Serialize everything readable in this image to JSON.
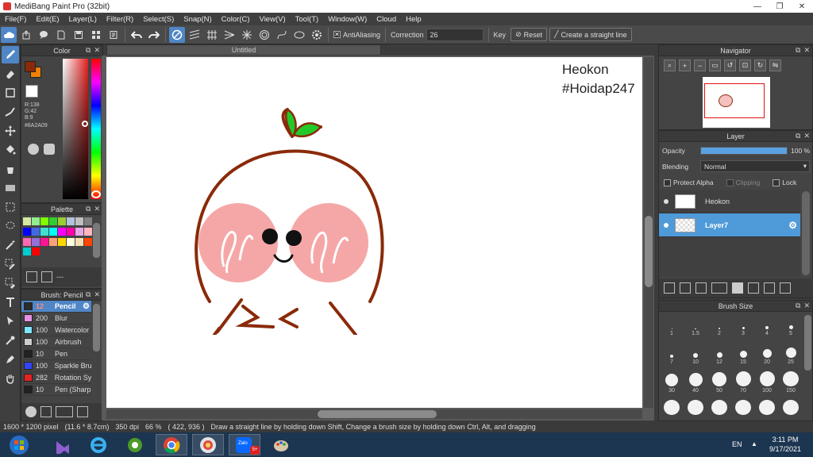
{
  "titlebar": {
    "title": "MediBang Paint Pro (32bit)",
    "minimize": "—",
    "maximize": "❐",
    "close": "✕"
  },
  "menu": [
    "File(F)",
    "Edit(E)",
    "Layer(L)",
    "Filter(R)",
    "Select(S)",
    "Snap(N)",
    "Color(C)",
    "View(V)",
    "Tool(T)",
    "Window(W)",
    "Cloud",
    "Help"
  ],
  "toolbar": {
    "antialiasing": "AntiAliasing",
    "correction_label": "Correction",
    "correction_value": "26",
    "key_label": "Key",
    "reset_label": "Reset",
    "straight_line_label": "Create a straight line"
  },
  "document": {
    "tab": "Untitled",
    "canvas_text_line1": "Heokon",
    "canvas_text_line2": "#Hoidap247"
  },
  "color_panel": {
    "title": "Color",
    "r": "R:138",
    "g": "G:42",
    "b": "B:9",
    "hex": "#8A2A09",
    "primary": "#8A2A09"
  },
  "palette_panel": {
    "title": "Palette",
    "more": "---",
    "colors": [
      "#d6e8a2",
      "#90ee90",
      "#7fff00",
      "#32cd32",
      "#9acd32",
      "#b0c4de",
      "#c0c0c0",
      "#808080",
      "#0000ff",
      "#4169e1",
      "#40e0d0",
      "#00ffff",
      "#ff00ff",
      "#ff00aa",
      "#e6a8e6",
      "#ffb6c1",
      "#ff69b4",
      "#9370db",
      "#ff1493",
      "#ffa07a",
      "#ffd700",
      "#ffffe0",
      "#f5deb3",
      "#ff4500",
      "#00ced1",
      "#ff0000"
    ]
  },
  "brush_panel": {
    "title": "Brush: Pencil",
    "items": [
      {
        "size": "12",
        "name": "Pencil",
        "color": "#2b2b2b"
      },
      {
        "size": "200",
        "name": "Blur",
        "color": "#e690e6"
      },
      {
        "size": "100",
        "name": "Watercolor",
        "color": "#7fe6ff"
      },
      {
        "size": "100",
        "name": "Airbrush",
        "color": "#cccccc"
      },
      {
        "size": "10",
        "name": "Pen",
        "color": "#222222"
      },
      {
        "size": "100",
        "name": "Sparkle Bru",
        "color": "#3344ff"
      },
      {
        "size": "282",
        "name": "Rotation Sy",
        "color": "#e62222"
      },
      {
        "size": "10",
        "name": "Pen (Sharp",
        "color": "#222222"
      }
    ]
  },
  "navigator": {
    "title": "Navigator"
  },
  "layer_panel": {
    "title": "Layer",
    "opacity_label": "Opacity",
    "opacity_value": "100 %",
    "opacity": 1.0,
    "blending_label": "Blending",
    "blending_value": "Normal",
    "protect_alpha": "Protect Alpha",
    "clipping": "Clipping",
    "lock": "Lock",
    "layers": [
      {
        "name": "Heokon",
        "selected": false
      },
      {
        "name": "Layer7",
        "selected": true
      }
    ]
  },
  "brush_size_panel": {
    "title": "Brush Size",
    "sizes": [
      "1",
      "1.5",
      "2",
      "3",
      "4",
      "5",
      "7",
      "10",
      "12",
      "15",
      "20",
      "25",
      "30",
      "40",
      "50",
      "70",
      "100",
      "150",
      "",
      "",
      "",
      "",
      "",
      ""
    ]
  },
  "status": {
    "dimensions": "1600 * 1200 pixel",
    "physical": "(11.6 * 8.7cm)",
    "dpi": "350 dpi",
    "zoom": "66 %",
    "cursor": "( 422, 936 )",
    "hint": "Draw a straight line by holding down Shift, Change a brush size by holding down Ctrl, Alt, and dragging"
  },
  "taskbar": {
    "lang": "EN",
    "time": "3:11 PM",
    "date": "9/17/2021",
    "zalo_label": "Zalo",
    "zalo_badge": "5+"
  }
}
